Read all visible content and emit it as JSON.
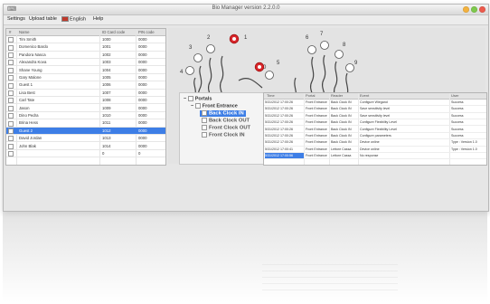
{
  "window": {
    "title": "Bio Manager version 2.2.0.0",
    "app_icon": "app-icon",
    "buttons": {
      "minimize_color": "#f3b23e",
      "maximize_color": "#7ec94d",
      "close_color": "#ec5b4d"
    }
  },
  "menu": {
    "settings": "Settings",
    "upload_table": "Upload table",
    "language": "English",
    "help": "Help"
  },
  "users": {
    "columns": [
      "#",
      "Name",
      "ID Card code",
      "PIN code"
    ],
    "rows": [
      {
        "name": "Tim Smith",
        "card": "1000",
        "pin": "0000"
      },
      {
        "name": "Domenico Bardo",
        "card": "1001",
        "pin": "0000"
      },
      {
        "name": "Pandora Nasca",
        "card": "1002",
        "pin": "0000"
      },
      {
        "name": "Alexandra Kova",
        "card": "1003",
        "pin": "0000"
      },
      {
        "name": "Shane Young",
        "card": "1004",
        "pin": "0000"
      },
      {
        "name": "Gary Malone",
        "card": "1005",
        "pin": "0000"
      },
      {
        "name": "Guest 1",
        "card": "1006",
        "pin": "0000"
      },
      {
        "name": "Lisa Best",
        "card": "1007",
        "pin": "0000"
      },
      {
        "name": "Carl Tate",
        "card": "1008",
        "pin": "0000"
      },
      {
        "name": "Jason",
        "card": "1009",
        "pin": "0000"
      },
      {
        "name": "Dino Pedra",
        "card": "1010",
        "pin": "0000"
      },
      {
        "name": "Brina Hess",
        "card": "1011",
        "pin": "0000"
      },
      {
        "name": "Guest 2",
        "card": "1012",
        "pin": "0000"
      },
      {
        "name": "David Jordan",
        "card": "1013",
        "pin": "0000"
      },
      {
        "name": "John Blak",
        "card": "1014",
        "pin": "0000"
      },
      {
        "name": "",
        "card": "0",
        "pin": "0"
      }
    ],
    "selected_index": 12
  },
  "fingers": {
    "left_labels": [
      "4",
      "3",
      "2",
      "1"
    ],
    "left_thumb_label": "0",
    "right_thumb_label": "5",
    "right_labels": [
      "6",
      "7",
      "8",
      "9"
    ],
    "marked": [
      "1",
      "5"
    ]
  },
  "tree": {
    "root": "Portals",
    "child": "Front Entrance",
    "items": [
      {
        "label": "Back Clock IN",
        "selected": true
      },
      {
        "label": "Back Clock OUT",
        "selected": false
      },
      {
        "label": "Front Clock OUT",
        "selected": false
      },
      {
        "label": "Front Clock IN",
        "selected": false
      }
    ]
  },
  "events": {
    "columns": [
      "Time",
      "Portal",
      "Reader",
      "Event",
      "User"
    ],
    "rows": [
      {
        "time": "5/31/2012 17:00:26",
        "portal": "Front Entrance",
        "reader": "Back Clock IN",
        "event": "Configure Wiegand",
        "user": "Success"
      },
      {
        "time": "5/31/2012 17:00:26",
        "portal": "Front Entrance",
        "reader": "Back Clock IN",
        "event": "Save sensitivity level",
        "user": "Success"
      },
      {
        "time": "5/31/2012 17:00:26",
        "portal": "Front Entrance",
        "reader": "Back Clock IN",
        "event": "Save sensitivity level",
        "user": "Success"
      },
      {
        "time": "5/31/2012 17:00:26",
        "portal": "Front Entrance",
        "reader": "Back Clock IN",
        "event": "Configure Flexibility Level",
        "user": "Success"
      },
      {
        "time": "5/31/2012 17:00:26",
        "portal": "Front Entrance",
        "reader": "Back Clock IN",
        "event": "Configure Flexibility Level",
        "user": "Success"
      },
      {
        "time": "5/31/2012 17:00:26",
        "portal": "Front Entrance",
        "reader": "Back Clock IN",
        "event": "Configure parameters",
        "user": "Success"
      },
      {
        "time": "5/31/2012 17:00:26",
        "portal": "Front Entrance",
        "reader": "Back Clock IN",
        "event": "Device online",
        "user": "Type : Version 1.0"
      },
      {
        "time": "5/31/2012 17:00:41",
        "portal": "Front Entrance",
        "reader": "Lettore Cassa",
        "event": "Device online",
        "user": "Type : Version 1.0"
      },
      {
        "time": "5/31/2012 17:00:56",
        "portal": "Front Entrance",
        "reader": "Lettore Cassa",
        "event": "No response",
        "user": ""
      }
    ]
  }
}
